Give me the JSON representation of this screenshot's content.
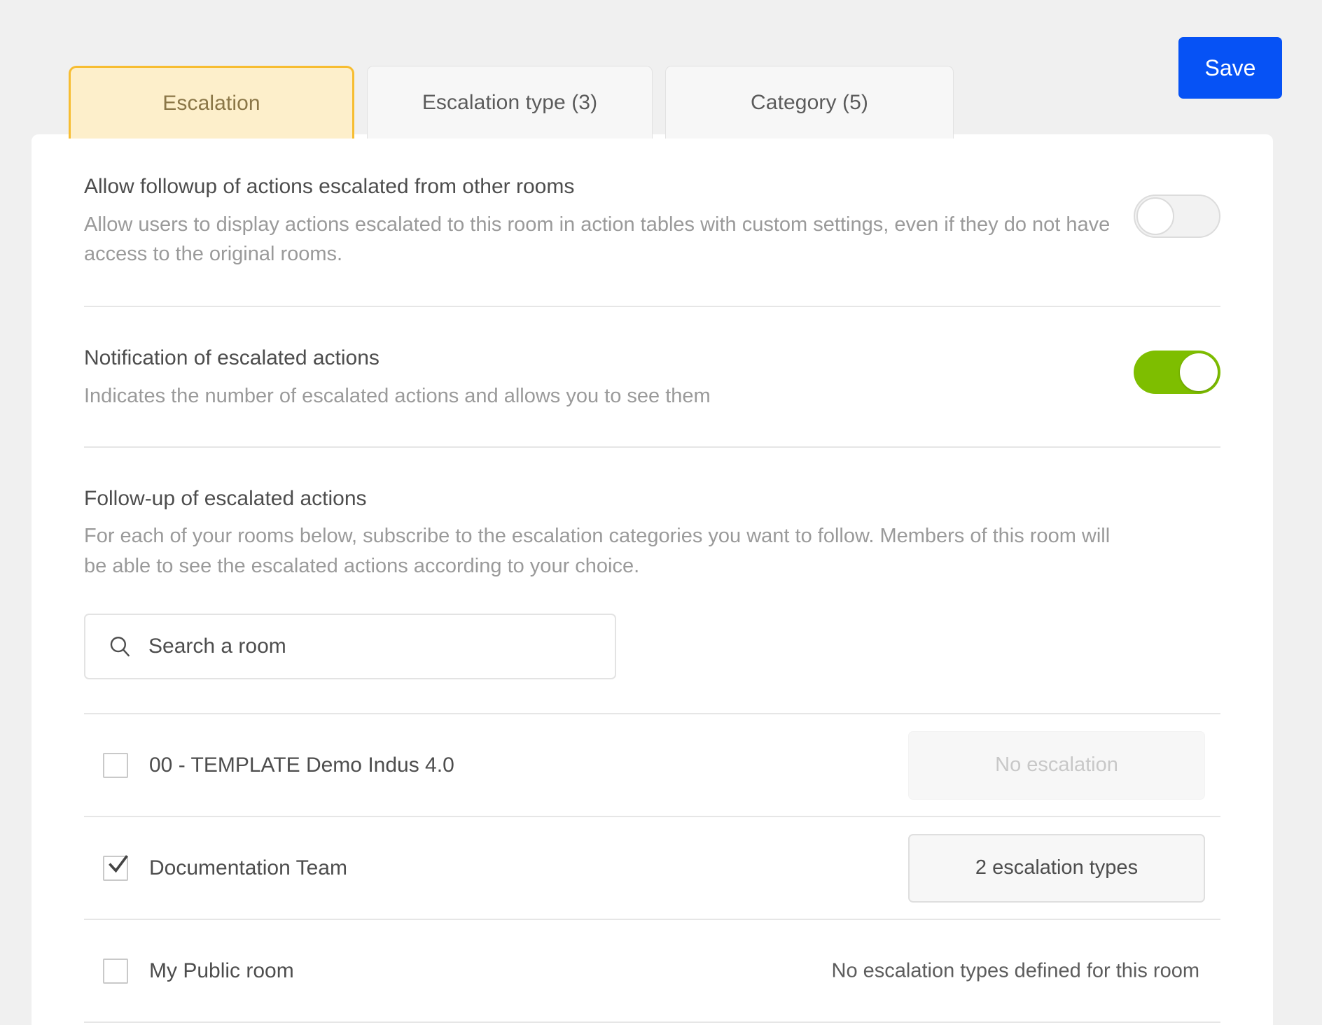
{
  "tabs": [
    {
      "label": "Escalation",
      "active": true,
      "name": "tab-escalation"
    },
    {
      "label": "Escalation type (3)",
      "active": false,
      "name": "tab-escalation-type"
    },
    {
      "label": "Category (5)",
      "active": false,
      "name": "tab-category"
    }
  ],
  "toolbar": {
    "save_label": "Save",
    "save_color": "#0652F5"
  },
  "colors": {
    "active_tab_border": "#F7BD31",
    "active_tab_fill": "#FDEFCB",
    "toggle_on": "#7EBE00",
    "divider": "#E6E6E6",
    "page_background": "#F0F0F0",
    "card_background": "#FFFFFF"
  },
  "settings": [
    {
      "title": "Allow followup of actions escalated from other rooms",
      "description": "Allow users to display actions escalated to this room in action tables with custom settings, even if they do not have access to the original rooms.",
      "toggle_state": "off"
    },
    {
      "title": "Notification of escalated actions",
      "description": "Indicates the number of escalated actions and allows you to see them",
      "toggle_state": "on"
    }
  ],
  "followup": {
    "title": "Follow-up of escalated actions",
    "description": "For each of your rooms below, subscribe to the escalation categories you want to follow. Members of this room will be able to see the escalated actions according to your choice.",
    "search": {
      "placeholder": "Search a room",
      "value": "",
      "icon": "search-icon"
    },
    "rooms": [
      {
        "name": "00 - TEMPLATE Demo Indus 4.0",
        "checked": false,
        "action_kind": "button-disabled",
        "action_label": "No escalation"
      },
      {
        "name": "Documentation Team",
        "checked": true,
        "action_kind": "button-enabled",
        "action_label": "2 escalation types"
      },
      {
        "name": "My Public room",
        "checked": false,
        "action_kind": "text",
        "action_label": "No escalation types defined for this room"
      }
    ]
  }
}
